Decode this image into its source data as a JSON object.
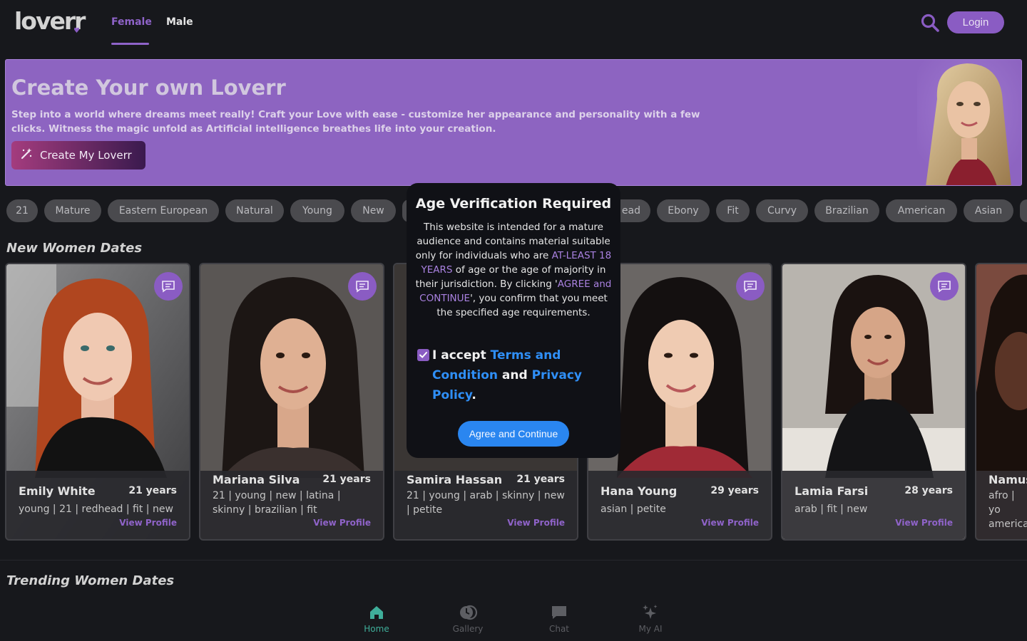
{
  "header": {
    "logo_text": "loverr",
    "tabs": [
      {
        "label": "Female",
        "active": true
      },
      {
        "label": "Male",
        "active": false
      }
    ],
    "search_icon": "search-icon",
    "login_label": "Login"
  },
  "banner": {
    "title": "Create Your own Loverr",
    "description": "Step into a world where dreams meet really! Craft your Love with ease - customize her appearance and personality with a few clicks. Witness the magic unfold as Artificial intelligence breathes life into your creation.",
    "button_label": "Create My Loverr",
    "button_icon": "magic-wand-icon"
  },
  "tags": [
    "21",
    "Mature",
    "Eastern European",
    "Natural",
    "Young",
    "New",
    "ead",
    "Ebony",
    "Fit",
    "Curvy",
    "Brazilian",
    "American",
    "Asian"
  ],
  "sections": {
    "new_title": "New Women Dates",
    "trending_title": "Trending Women Dates"
  },
  "cards": [
    {
      "name": "Emily White",
      "age": "21 years",
      "tags": "young | 21 | redhead | fit | new",
      "link": "View Profile"
    },
    {
      "name": "Mariana Silva",
      "age": "21 years",
      "tags": "21 | young | new | latina | skinny | brazilian | fit",
      "link": "View Profile"
    },
    {
      "name": "Samira Hassan",
      "age": "21 years",
      "tags": "21 | young | arab | skinny | new | petite",
      "link": "View Profile"
    },
    {
      "name": "Hana Young",
      "age": "29 years",
      "tags": "asian | petite",
      "link": "View Profile"
    },
    {
      "name": "Lamia Farsi",
      "age": "28 years",
      "tags": "arab | fit | new",
      "link": "View Profile"
    },
    {
      "name": "Namus",
      "age": "",
      "tags": "afro | yo america",
      "link": ""
    }
  ],
  "modal": {
    "title": "Age Verification Required",
    "text_1": "This website is intended for a mature audience and contains material suitable only for individuals who are ",
    "text_hl_1": "AT-LEAST 18 YEARS",
    "text_2": " of age or the age of majority in their jurisdiction. By clicking '",
    "text_hl_2": "AGREE and CONTINUE",
    "text_3": "', you confirm that you meet the specified age requirements.",
    "accept_prefix": "I accept ",
    "terms_link": "Terms and Condition",
    "and_word": " and ",
    "privacy_link": "Privacy Policy",
    "period": ".",
    "checkbox_checked": true,
    "agree_button": "Agree and Continue"
  },
  "bottom_nav": [
    {
      "label": "Home",
      "icon": "home-icon",
      "active": true
    },
    {
      "label": "Gallery",
      "icon": "gallery-icon",
      "active": false
    },
    {
      "label": "Chat",
      "icon": "chat-icon",
      "active": false
    },
    {
      "label": "My AI",
      "icon": "sparkles-icon",
      "active": false
    }
  ],
  "colors": {
    "accent": "#8a5cc3",
    "banner_bg": "#8d64c1",
    "agree_button": "#2a86f0",
    "active_nav": "#3fae9a",
    "background": "#17181c"
  }
}
